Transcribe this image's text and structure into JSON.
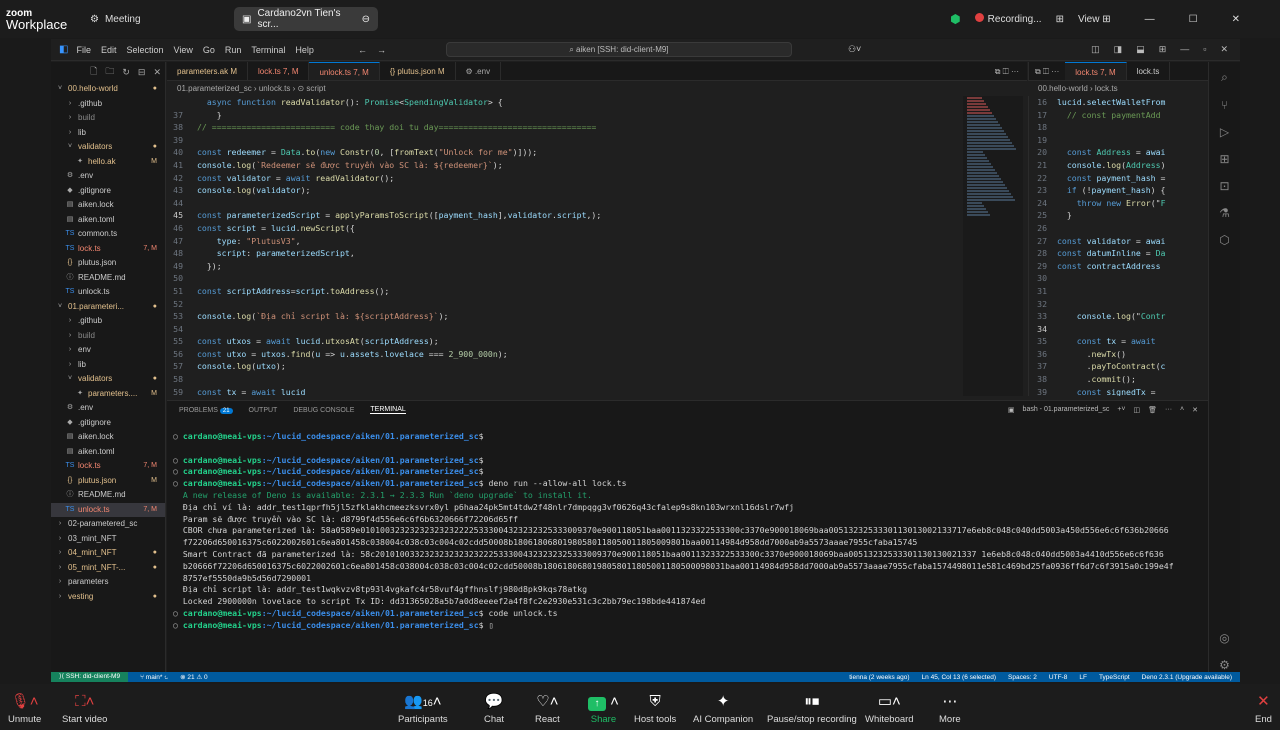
{
  "zoom": {
    "logo_line1": "zoom",
    "logo_line2": "Workplace",
    "meeting_label": "Meeting",
    "share_tab": "Cardano2vn Tien's scr...",
    "recording": "Recording...",
    "view": "View",
    "bottom": {
      "unmute": "Unmute",
      "start_video": "Start video",
      "participants": "Participants",
      "participants_count": "16",
      "chat": "Chat",
      "react": "React",
      "share": "Share",
      "host_tools": "Host tools",
      "ai_companion": "AI Companion",
      "pause_recording": "Pause/stop recording",
      "whiteboard": "Whiteboard",
      "more": "More",
      "end": "End"
    }
  },
  "vscode": {
    "menu": [
      "File",
      "Edit",
      "Selection",
      "View",
      "Go",
      "Run",
      "Terminal",
      "Help"
    ],
    "search": "aiken [SSH: did-client-M9]",
    "tabs": [
      {
        "label": "parameters.ak  M",
        "active": false
      },
      {
        "label": "lock.ts  7, M",
        "active": false
      },
      {
        "label": "unlock.ts  7, M",
        "active": true
      },
      {
        "label": "{}  plutus.json  M",
        "active": false
      },
      {
        "label": "⚙  .env",
        "active": false
      }
    ],
    "breadcrumb": "01.parameterized_sc  ›  unlock.ts  ›  ⊙ script",
    "right_tab": "lock.ts  7, M",
    "right_tab2": "lock.ts",
    "right_breadcrumb": "00.hello-world  ›  lock.ts",
    "explorer": [
      {
        "label": "00.hello-world",
        "depth": 0,
        "icon": "˅",
        "badge": "●",
        "color": "#e2c08d"
      },
      {
        "label": ".github",
        "depth": 1,
        "icon": "›",
        "badge": "",
        "color": "#ccc"
      },
      {
        "label": "build",
        "depth": 1,
        "icon": "›",
        "badge": "",
        "color": "#8a8a8a"
      },
      {
        "label": "lib",
        "depth": 1,
        "icon": "›",
        "badge": "",
        "color": "#ccc"
      },
      {
        "label": "validators",
        "depth": 1,
        "icon": "˅",
        "badge": "●",
        "color": "#e2c08d"
      },
      {
        "label": "hello.ak",
        "depth": 2,
        "icon": "✦",
        "badge": "M",
        "color": "#e2c08d"
      },
      {
        "label": ".env",
        "depth": 1,
        "icon": "⚙",
        "badge": "",
        "color": "#ccc"
      },
      {
        "label": ".gitignore",
        "depth": 1,
        "icon": "◆",
        "badge": "",
        "color": "#ccc"
      },
      {
        "label": "aiken.lock",
        "depth": 1,
        "icon": "▤",
        "badge": "",
        "color": "#ccc"
      },
      {
        "label": "aiken.toml",
        "depth": 1,
        "icon": "▤",
        "badge": "",
        "color": "#ccc"
      },
      {
        "label": "common.ts",
        "depth": 1,
        "icon": "TS",
        "badge": "",
        "color": "#ccc"
      },
      {
        "label": "lock.ts",
        "depth": 1,
        "icon": "TS",
        "badge": "7, M",
        "color": "#f48771"
      },
      {
        "label": "plutus.json",
        "depth": 1,
        "icon": "{}",
        "badge": "",
        "color": "#ccc"
      },
      {
        "label": "README.md",
        "depth": 1,
        "icon": "ⓘ",
        "badge": "",
        "color": "#ccc"
      },
      {
        "label": "unlock.ts",
        "depth": 1,
        "icon": "TS",
        "badge": "",
        "color": "#ccc"
      },
      {
        "label": "01.parameteri...",
        "depth": 0,
        "icon": "˅",
        "badge": "●",
        "color": "#e2c08d"
      },
      {
        "label": ".github",
        "depth": 1,
        "icon": "›",
        "badge": "",
        "color": "#ccc"
      },
      {
        "label": "build",
        "depth": 1,
        "icon": "›",
        "badge": "",
        "color": "#8a8a8a"
      },
      {
        "label": "env",
        "depth": 1,
        "icon": "›",
        "badge": "",
        "color": "#ccc"
      },
      {
        "label": "lib",
        "depth": 1,
        "icon": "›",
        "badge": "",
        "color": "#ccc"
      },
      {
        "label": "validators",
        "depth": 1,
        "icon": "˅",
        "badge": "●",
        "color": "#e2c08d"
      },
      {
        "label": "parameters....",
        "depth": 2,
        "icon": "✦",
        "badge": "M",
        "color": "#e2c08d"
      },
      {
        "label": ".env",
        "depth": 1,
        "icon": "⚙",
        "badge": "",
        "color": "#ccc"
      },
      {
        "label": ".gitignore",
        "depth": 1,
        "icon": "◆",
        "badge": "",
        "color": "#ccc"
      },
      {
        "label": "aiken.lock",
        "depth": 1,
        "icon": "▤",
        "badge": "",
        "color": "#ccc"
      },
      {
        "label": "aiken.toml",
        "depth": 1,
        "icon": "▤",
        "badge": "",
        "color": "#ccc"
      },
      {
        "label": "lock.ts",
        "depth": 1,
        "icon": "TS",
        "badge": "7, M",
        "color": "#f48771"
      },
      {
        "label": "plutus.json",
        "depth": 1,
        "icon": "{}",
        "badge": "M",
        "color": "#e2c08d"
      },
      {
        "label": "README.md",
        "depth": 1,
        "icon": "ⓘ",
        "badge": "",
        "color": "#ccc"
      },
      {
        "label": "unlock.ts",
        "depth": 1,
        "icon": "TS",
        "badge": "7, M",
        "color": "#f48771",
        "selected": true
      },
      {
        "label": "02-parametered_sc",
        "depth": 0,
        "icon": "›",
        "badge": "",
        "color": "#ccc"
      },
      {
        "label": "03_mint_NFT",
        "depth": 0,
        "icon": "›",
        "badge": "",
        "color": "#ccc"
      },
      {
        "label": "04_mint_NFT",
        "depth": 0,
        "icon": "›",
        "badge": "●",
        "color": "#e2c08d"
      },
      {
        "label": "05_mint_NFT-...",
        "depth": 0,
        "icon": "›",
        "badge": "●",
        "color": "#e2c08d"
      },
      {
        "label": "parameters",
        "depth": 0,
        "icon": "›",
        "badge": "",
        "color": "#ccc"
      },
      {
        "label": "vesting",
        "depth": 0,
        "icon": "›",
        "badge": "●",
        "color": "#e2c08d"
      }
    ],
    "code_lines": [
      {
        "n": "",
        "t": "  async function readValidator(): Promise<SpendingValidator> {"
      },
      {
        "n": "37",
        "t": "    }"
      },
      {
        "n": "38",
        "t": "// ========================= code thay doi tu day================================"
      },
      {
        "n": "39",
        "t": ""
      },
      {
        "n": "40",
        "t": "const redeemer = Data.to(new Constr(0, [fromText(\"Unlock for me\")]));"
      },
      {
        "n": "41",
        "t": "console.log(`Redeemer sẽ được truyền vào SC là: ${redeemer}`);"
      },
      {
        "n": "42",
        "t": "const validator = await readValidator();"
      },
      {
        "n": "43",
        "t": "console.log(validator);"
      },
      {
        "n": "44",
        "t": ""
      },
      {
        "n": "45",
        "t": "const parameterizedScript = applyParamsToScript([payment_hash],validator.script,);"
      },
      {
        "n": "46",
        "t": "const script = lucid.newScript({"
      },
      {
        "n": "47",
        "t": "    type: \"PlutusV3\","
      },
      {
        "n": "48",
        "t": "    script: parameterizedScript,"
      },
      {
        "n": "49",
        "t": "  });"
      },
      {
        "n": "50",
        "t": ""
      },
      {
        "n": "51",
        "t": "const scriptAddress=script.toAddress();"
      },
      {
        "n": "52",
        "t": ""
      },
      {
        "n": "53",
        "t": "console.log(`Địa chỉ script là: ${scriptAddress}`);"
      },
      {
        "n": "54",
        "t": ""
      },
      {
        "n": "55",
        "t": "const utxos = await lucid.utxosAt(scriptAddress);"
      },
      {
        "n": "56",
        "t": "const utxo = utxos.find(u => u.assets.lovelace === 2_900_000n);"
      },
      {
        "n": "57",
        "t": "console.log(utxo);"
      },
      {
        "n": "58",
        "t": ""
      },
      {
        "n": "59",
        "t": "const tx = await lucid"
      }
    ],
    "right_code_lines": [
      {
        "n": "16",
        "t": "lucid.selectWalletFrom"
      },
      {
        "n": "17",
        "t": "  // const paymentAdd"
      },
      {
        "n": "18",
        "t": ""
      },
      {
        "n": "19",
        "t": ""
      },
      {
        "n": "20",
        "t": "  const Address = awai"
      },
      {
        "n": "21",
        "t": "  console.log(Address)"
      },
      {
        "n": "22",
        "t": "  const payment_hash ="
      },
      {
        "n": "23",
        "t": "  if (!payment_hash) {"
      },
      {
        "n": "24",
        "t": "    throw new Error(\"F"
      },
      {
        "n": "25",
        "t": "  }"
      },
      {
        "n": "26",
        "t": ""
      },
      {
        "n": "27",
        "t": "const validator = awai"
      },
      {
        "n": "28",
        "t": "const datumInline = Da"
      },
      {
        "n": "29",
        "t": "const contractAddress"
      },
      {
        "n": "30",
        "t": ""
      },
      {
        "n": "31",
        "t": ""
      },
      {
        "n": "32",
        "t": ""
      },
      {
        "n": "33",
        "t": "    console.log(\"Contr"
      },
      {
        "n": "34",
        "t": ""
      },
      {
        "n": "35",
        "t": "    const tx = await"
      },
      {
        "n": "36",
        "t": "      .newTx()"
      },
      {
        "n": "37",
        "t": "      .payToContract(c"
      },
      {
        "n": "38",
        "t": "      .commit();"
      },
      {
        "n": "39",
        "t": "    const signedTx ="
      }
    ],
    "panel": {
      "tabs": [
        "PROBLEMS",
        "OUTPUT",
        "DEBUG CONSOLE",
        "TERMINAL"
      ],
      "problems_count": "21",
      "terminal_name": "bash - 01.parameterized_sc"
    },
    "terminal": [
      {
        "kind": "prompt",
        "user": "cardano@meai-vps",
        "path": ":~/lucid_codespace/aiken/01.parameterized_sc",
        "cmd": "$"
      },
      {
        "kind": "blank",
        "text": ""
      },
      {
        "kind": "prompt",
        "user": "cardano@meai-vps",
        "path": ":~/lucid_codespace/aiken/01.parameterized_sc",
        "cmd": "$"
      },
      {
        "kind": "prompt",
        "user": "cardano@meai-vps",
        "path": ":~/lucid_codespace/aiken/01.parameterized_sc",
        "cmd": "$"
      },
      {
        "kind": "prompt",
        "user": "cardano@meai-vps",
        "path": ":~/lucid_codespace/aiken/01.parameterized_sc",
        "cmd": "$ deno run --allow-all lock.ts"
      },
      {
        "kind": "green",
        "text": "A new release of Deno is available: 2.3.1 → 2.3.3 Run `deno upgrade` to install it."
      },
      {
        "kind": "out",
        "text": "Địa chỉ ví là: addr_test1qprfh5jl5zfklakhcmeezksvrx0yl p6haa24pk5mt4tdw2f48nlr7dmpqgg3vf0626q43cfalep9s8kn103wrxnl16dslr7wfj"
      },
      {
        "kind": "out",
        "text": "Param sẽ được truyền vào SC là: d8799f4d556e6c6f6b6320666f72206d65ff"
      },
      {
        "kind": "out",
        "text": "CBOR chưa parameterized là: 58a0589e010100323232323232322225333004323232325333009370e900118051baa0011323322533300c3370e900018069baa0051323253330113013002133717e6eb8c048c040dd5003a450d556e6c6f636b20666"
      },
      {
        "kind": "out",
        "text": "f72206d650016375c6022002601c6ea801458c038004c038c03c004c02cdd50008b18061806801980580118050011805009801baa00114984d958dd7000ab9a5573aaae7955cfaba15745"
      },
      {
        "kind": "out",
        "text": "Smart Contract đã parameterized là: 58c2010100332323232323232225333004323232325333009370e900118051baa0011323322533300c3370e900018069baa00513232533301130130021337 1e6eb8c048c040dd5003a4410d556e6c6f636"
      },
      {
        "kind": "out",
        "text": "b20666f72206d650016375c6022002601c6ea801458c038004c038c03c004c02cdd50008b1806180680198058011805001180500098031baa00114984d958dd7000ab9a5573aaae7955cfaba1574498011e581c469bd25fa0936ff6d7c6f3915a0c199e4f"
      },
      {
        "kind": "out",
        "text": "8757ef5550da9b5d56d7290001"
      },
      {
        "kind": "out",
        "text": "Địa chỉ script là: addr_test1wqkvzv8tp93l4vgkafc4r58vuf4gffhnslfj980d8pk9kqs78atkg"
      },
      {
        "kind": "out",
        "text": "Locked 2900000n lovelace to script Tx ID: dd31365028a5b7a0d8eeeef2a4f8fc2e2930e531c3c2bb79ec198bde441874ed"
      },
      {
        "kind": "prompt",
        "user": "cardano@meai-vps",
        "path": ":~/lucid_codespace/aiken/01.parameterized_sc",
        "cmd": "$ code unlock.ts"
      },
      {
        "kind": "prompt",
        "user": "cardano@meai-vps",
        "path": ":~/lucid_codespace/aiken/01.parameterized_sc",
        "cmd": "$ ▯"
      }
    ],
    "status": {
      "remote": "SSH: did-client-M9",
      "branch": "main*",
      "errors": "⊗ 21 ⚠ 0",
      "blame": "tienna (2 weeks ago)",
      "position": "Ln 45, Col 13 (6 selected)",
      "spaces": "Spaces: 2",
      "encoding": "UTF-8",
      "eol": "LF",
      "language": "TypeScript",
      "deno": "Deno 2.3.1 (Upgrade available)"
    }
  },
  "colors": {
    "accent": "#0078d4",
    "status_bar": "#005a9e",
    "remote": "#16825d",
    "share_green": "#1fbe66"
  }
}
